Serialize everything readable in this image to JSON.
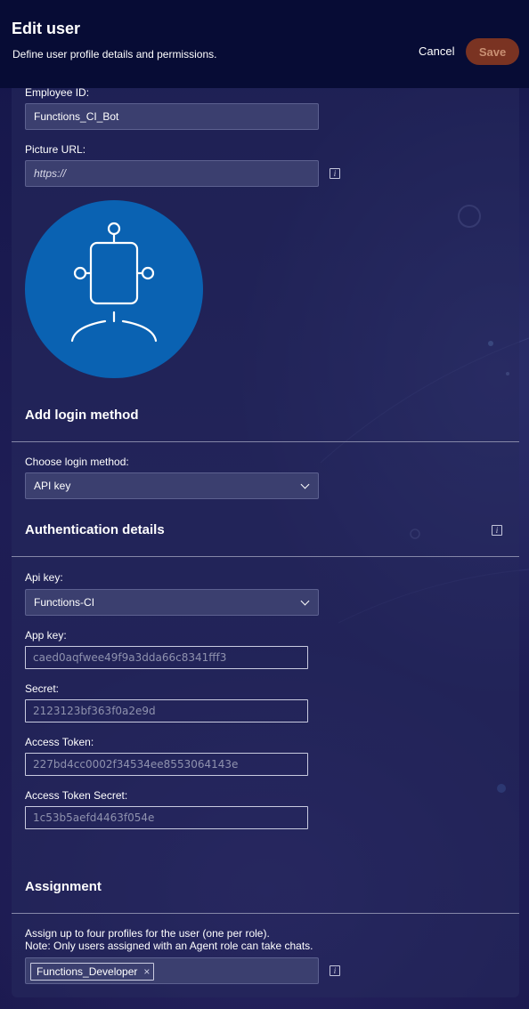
{
  "header": {
    "title": "Edit user",
    "subtitle": "Define user profile details and permissions.",
    "cancel_label": "Cancel",
    "save_label": "Save"
  },
  "profile": {
    "employee_id_label": "Employee ID:",
    "employee_id_value": "Functions_CI_Bot",
    "picture_url_label": "Picture URL:",
    "picture_url_placeholder": "https://"
  },
  "login": {
    "section_title": "Add login method",
    "choose_label": "Choose login method:",
    "method_value": "API key"
  },
  "auth": {
    "section_title": "Authentication details",
    "api_key_label": "Api key:",
    "api_key_value": "Functions-CI",
    "app_key_label": "App key:",
    "app_key_value": "caed0aqfwee49f9a3dda66c8341fff3",
    "secret_label": "Secret:",
    "secret_value": "2123123bf363f0a2e9d",
    "access_token_label": "Access Token:",
    "access_token_value": "227bd4cc0002f34534ee8553064143e",
    "access_token_secret_label": "Access Token Secret:",
    "access_token_secret_value": "1c53b5aefd4463f054e"
  },
  "assignment": {
    "section_title": "Assignment",
    "note_line1": "Assign up to four profiles for the user (one per role).",
    "note_line2": "Note: Only users assigned with an Agent role can take chats.",
    "profiles": [
      "Functions_Developer"
    ],
    "remove_symbol": "×"
  },
  "colors": {
    "header_bg": "#070c35",
    "save_button": "#7a3322",
    "avatar": "#0a62b2",
    "page_bg": "#1b1a4e"
  },
  "icons": [
    "info-icon",
    "robot-avatar-icon",
    "chevron-down-icon",
    "remove-icon"
  ]
}
